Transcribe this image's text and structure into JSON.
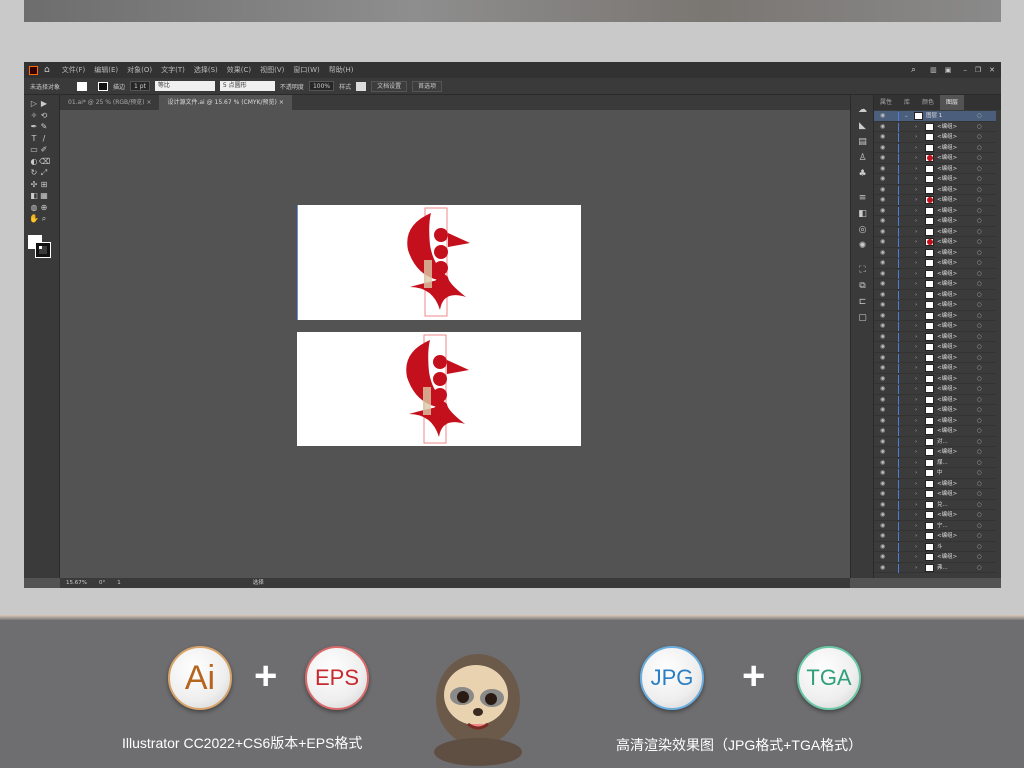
{
  "menu": [
    "文件(F)",
    "编辑(E)",
    "对象(O)",
    "文字(T)",
    "选择(S)",
    "效果(C)",
    "视图(V)",
    "窗口(W)",
    "帮助(H)"
  ],
  "control": {
    "selection": "未选择对象",
    "stroke_label": "描边",
    "stroke_value": "1 pt",
    "line_label": "等比",
    "brush": "5 点圆形",
    "opacity_label": "不透明度",
    "opacity": "100%",
    "style_label": "样式",
    "doc_setup": "文档设置",
    "prefs": "首选项"
  },
  "tabs": [
    {
      "label": "01.ai* @ 25 % (RGB/预览)"
    },
    {
      "label": "设计源文件.ai @ 15.67 % (CMYK/预览)"
    }
  ],
  "panel": {
    "tabs": [
      "属性",
      "库",
      "颜色",
      "图层"
    ],
    "layer_name": "图层 1",
    "rows": [
      {
        "name": "<编组>",
        "thumb": "white"
      },
      {
        "name": "<编组>",
        "thumb": "white"
      },
      {
        "name": "<编组>",
        "thumb": "white"
      },
      {
        "name": "<编组>",
        "thumb": "red"
      },
      {
        "name": "<编组>",
        "thumb": "white"
      },
      {
        "name": "<编组>",
        "thumb": "white"
      },
      {
        "name": "<编组>",
        "thumb": "white"
      },
      {
        "name": "<编组>",
        "thumb": "red"
      },
      {
        "name": "<编组>",
        "thumb": "white"
      },
      {
        "name": "<编组>",
        "thumb": "white"
      },
      {
        "name": "<编组>",
        "thumb": "white"
      },
      {
        "name": "<编组>",
        "thumb": "red"
      },
      {
        "name": "<编组>",
        "thumb": "white"
      },
      {
        "name": "<编组>",
        "thumb": "white"
      },
      {
        "name": "<编组>",
        "thumb": "white"
      },
      {
        "name": "<编组>",
        "thumb": "white"
      },
      {
        "name": "<编组>",
        "thumb": "white"
      },
      {
        "name": "<编组>",
        "thumb": "white"
      },
      {
        "name": "<编组>",
        "thumb": "white"
      },
      {
        "name": "<编组>",
        "thumb": "white"
      },
      {
        "name": "<编组>",
        "thumb": "white"
      },
      {
        "name": "<编组>",
        "thumb": "white"
      },
      {
        "name": "<编组>",
        "thumb": "white"
      },
      {
        "name": "<编组>",
        "thumb": "white"
      },
      {
        "name": "<编组>",
        "thumb": "white"
      },
      {
        "name": "<编组>",
        "thumb": "white"
      },
      {
        "name": "<编组>",
        "thumb": "white"
      },
      {
        "name": "<编组>",
        "thumb": "white"
      },
      {
        "name": "<编组>",
        "thumb": "white"
      },
      {
        "name": "<编组>",
        "thumb": "white"
      },
      {
        "name": "对...",
        "thumb": "white"
      },
      {
        "name": "<编组>",
        "thumb": "white"
      },
      {
        "name": "煤...",
        "thumb": "white"
      },
      {
        "name": "中",
        "thumb": "white"
      },
      {
        "name": "<编组>",
        "thumb": "white"
      },
      {
        "name": "<编组>",
        "thumb": "white"
      },
      {
        "name": "兑...",
        "thumb": "white"
      },
      {
        "name": "<编组>",
        "thumb": "white"
      },
      {
        "name": "宁...",
        "thumb": "white"
      },
      {
        "name": "<编组>",
        "thumb": "white"
      },
      {
        "name": "斗",
        "thumb": "white"
      },
      {
        "name": "<编组>",
        "thumb": "white"
      },
      {
        "name": "弗...",
        "thumb": "white"
      }
    ]
  },
  "status": {
    "zoom": "15.67%",
    "angle": "0°",
    "artboard": "1",
    "mode": "选择"
  },
  "banner": {
    "badges": [
      "Ai",
      "EPS",
      "JPG",
      "TGA"
    ],
    "plus": "+",
    "left_caption": "Illustrator CC2022+CS6版本+EPS格式",
    "right_caption": "高清渲染效果图（JPG格式+TGA格式）"
  },
  "colors": {
    "art_red": "#c4101c",
    "ai": "#b5651d",
    "eps": "#c8282e",
    "jpg": "#2a7fc4",
    "tga": "#2fa07a"
  }
}
